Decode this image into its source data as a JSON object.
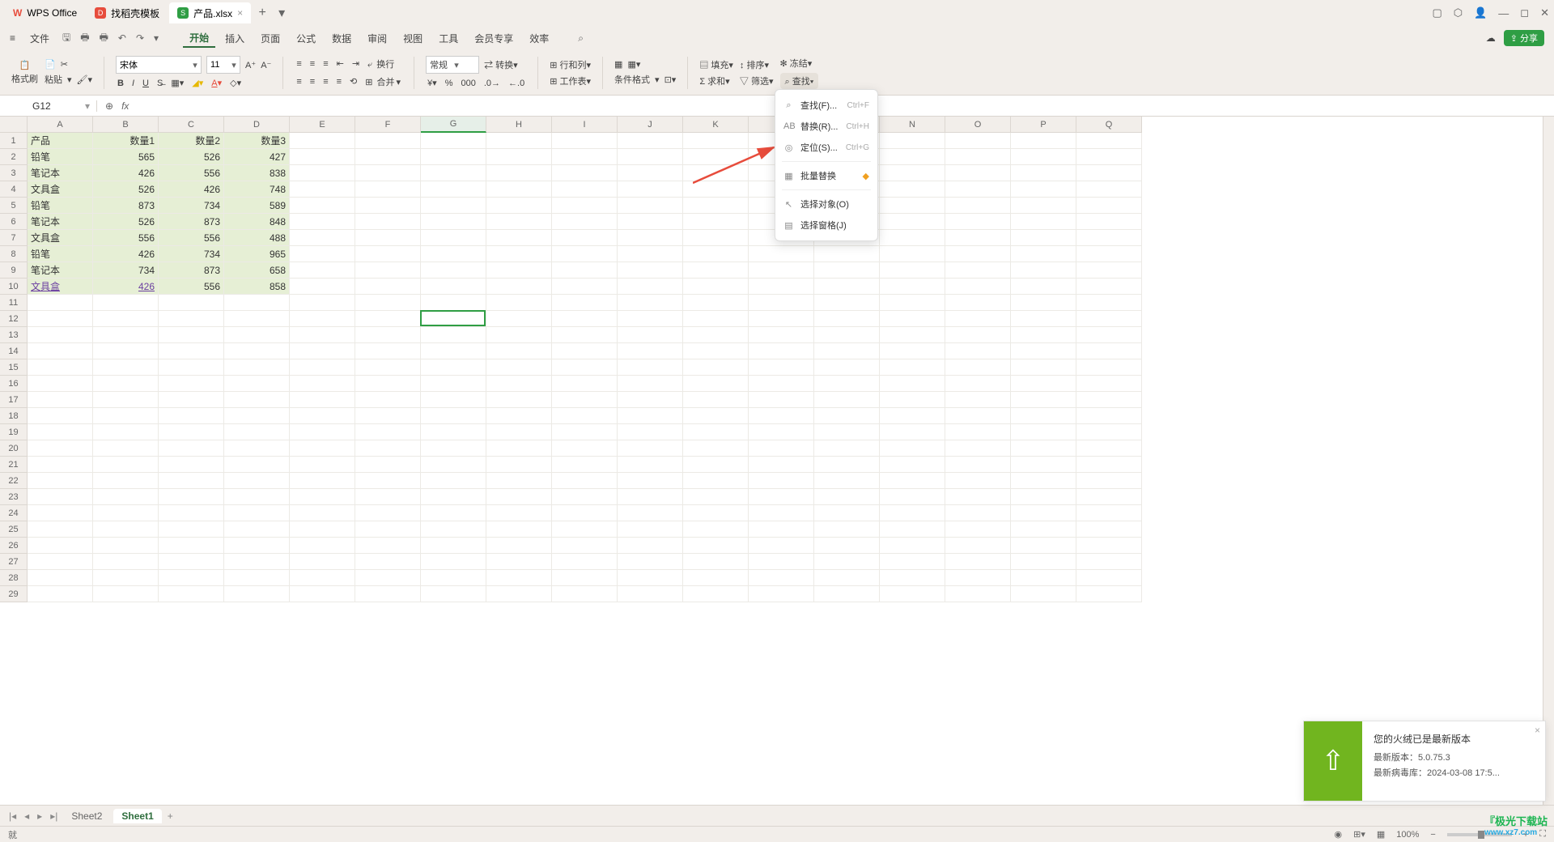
{
  "titlebar": {
    "app_name": "WPS Office",
    "tabs": [
      {
        "label": "找稻壳模板",
        "icon_color": "#e74c3c"
      },
      {
        "label": "产品.xlsx",
        "icon_letter": "S",
        "icon_color": "#2f9e44",
        "active": true
      }
    ]
  },
  "menubar": {
    "file": "文件",
    "items": [
      "开始",
      "插入",
      "页面",
      "公式",
      "数据",
      "审阅",
      "视图",
      "工具",
      "会员专享",
      "效率"
    ],
    "share": "分享"
  },
  "ribbon": {
    "brush": "格式刷",
    "paste": "粘贴",
    "font_name": "宋体",
    "font_size": "11",
    "wrap": "换行",
    "merge": "合并",
    "numfmt": "常规",
    "convert": "转换",
    "rowcol": "行和列",
    "worksheet": "工作表",
    "condfmt": "条件格式",
    "fill": "填充",
    "sort": "排序",
    "freeze": "冻结",
    "sum": "求和",
    "filter": "筛选",
    "find": "查找"
  },
  "formulabar": {
    "cellref": "G12",
    "fx": "fx"
  },
  "columns": [
    "A",
    "B",
    "C",
    "D",
    "E",
    "F",
    "G",
    "H",
    "I",
    "J",
    "K",
    "L",
    "M",
    "N",
    "O",
    "P",
    "Q"
  ],
  "rows_visible": 29,
  "table": {
    "header": [
      "产品",
      "数量1",
      "数量2",
      "数量3"
    ],
    "rows": [
      [
        "铅笔",
        "565",
        "526",
        "427"
      ],
      [
        "笔记本",
        "426",
        "556",
        "838"
      ],
      [
        "文具盒",
        "526",
        "426",
        "748"
      ],
      [
        "铅笔",
        "873",
        "734",
        "589"
      ],
      [
        "笔记本",
        "526",
        "873",
        "848"
      ],
      [
        "文具盒",
        "556",
        "556",
        "488"
      ],
      [
        "铅笔",
        "426",
        "734",
        "965"
      ],
      [
        "笔记本",
        "734",
        "873",
        "658"
      ],
      [
        "文具盒",
        "426",
        "556",
        "858"
      ]
    ],
    "link_cell": {
      "row": 9,
      "col": 0
    },
    "link_cell2": {
      "row": 9,
      "col": 1
    }
  },
  "dropdown": {
    "items": [
      {
        "icon": "⌕",
        "label": "查找(F)...",
        "shortcut": "Ctrl+F"
      },
      {
        "icon": "AB",
        "label": "替换(R)...",
        "shortcut": "Ctrl+H"
      },
      {
        "icon": "◎",
        "label": "定位(S)...",
        "shortcut": "Ctrl+G"
      },
      {
        "divider": true
      },
      {
        "icon": "▦",
        "label": "批量替换",
        "badge": true
      },
      {
        "divider": true
      },
      {
        "icon": "↖",
        "label": "选择对象(O)"
      },
      {
        "icon": "▤",
        "label": "选择窗格(J)"
      }
    ]
  },
  "sheets": {
    "tabs": [
      "Sheet2",
      "Sheet1"
    ],
    "active": 1
  },
  "statusbar": {
    "zoom": "100%",
    "ready": "就"
  },
  "toast": {
    "title": "您的火绒已是最新版本",
    "line2": "最新版本：5.0.75.3",
    "line3": "最新病毒库：2024-03-08 17:5..."
  },
  "watermark": {
    "l1": "『极光下载站",
    "l2": "www.xz7.com"
  }
}
